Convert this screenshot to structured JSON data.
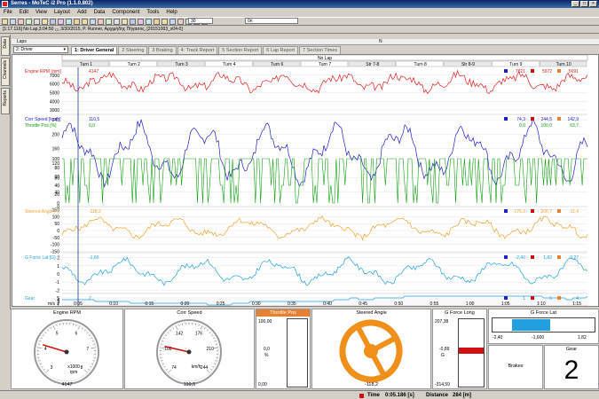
{
  "window": {
    "title": "Serres - MoTeC i2 Pro (1.1.0.802)"
  },
  "menu": [
    "File",
    "Edit",
    "View",
    "Layout",
    "Add",
    "Data",
    "Component",
    "Tools",
    "Help"
  ],
  "toolbar": {
    "combo_value": "30",
    "nav_combo_value": "0n"
  },
  "file_info": "[1:17.116] No Lap,3:04:50 ₁₂, 3/30/2015, P. Runner, Αρχιμήδης Πήγασος, [20151003_s04-0]",
  "side_tabs": [
    "Data",
    "Channels",
    "Reports"
  ],
  "laps_row": {
    "label": "Laps",
    "marker": "N"
  },
  "driver_select": "2: Driver",
  "tabs": [
    "1: Driver General",
    "2 Steering",
    "3 Braking",
    "4: Track Report",
    "5 Section Report",
    "6 Lap Report",
    "7 Section Times"
  ],
  "active_tab": 0,
  "chart": {
    "no_lap_label": "No Lap",
    "turns": [
      "Turn 1",
      "Turn 2",
      "Turn 3",
      "Turn 4",
      "Turn 6",
      "Turn 7",
      "Str 7-8",
      "Turn 8",
      "Str 8-9",
      "Turn 9",
      "Turn 10"
    ],
    "time_ticks": [
      "0:05",
      "0:10",
      "0:15",
      "0:20",
      "0:25",
      "0:30",
      "0:35",
      "0:40",
      "0:45",
      "0:50",
      "0:55",
      "1:00",
      "1:05",
      "1:10",
      "1:15"
    ],
    "x_unit": "m/s",
    "panels": [
      {
        "name": "Engine RPM [rpm]",
        "value": "4147",
        "ticks": [
          "7000",
          "6000",
          "5000",
          "4000",
          "3000"
        ],
        "stats": [
          "7821",
          "5972",
          "5691"
        ],
        "color": "#e02020"
      },
      {
        "name": "Corr Speed [km/h]",
        "value": "110,5",
        "ticks": [
          "240",
          "200",
          "160",
          "120",
          "80",
          "40",
          "0"
        ],
        "stats": [
          "74,3",
          "244,5",
          "142,9"
        ],
        "color": "#2020c8"
      },
      {
        "name": "Throttle Pos [%]",
        "value": "0,0",
        "ticks": [
          "100",
          "80",
          "60",
          "40",
          "20",
          "0"
        ],
        "stats": [
          "0,0",
          "100,0",
          "63,7"
        ],
        "color": "#10a010"
      },
      {
        "name": "Steered Angle [°]",
        "value": "-118,2",
        "ticks": [
          "150",
          "100",
          "50",
          "0",
          "-50",
          "-100",
          "-150"
        ],
        "stats": [
          "-176,3",
          "206,7",
          "11,4"
        ],
        "color": "#f0a030"
      },
      {
        "name": "G Force Lat [G]",
        "value": "-1,60",
        "ticks": [
          "2",
          "1",
          "0",
          "-1",
          "-2"
        ],
        "stats": [
          "-2,40",
          "1,82",
          "0,27"
        ],
        "color": "#20a0e0"
      },
      {
        "name": "Gear",
        "value": "2",
        "ticks": [
          "5",
          "4",
          "3",
          "2",
          "1"
        ],
        "stats": [
          "1",
          "6",
          "4"
        ],
        "color": "#20a0e0"
      }
    ]
  },
  "gauges": {
    "rpm": {
      "title": "Engine RPM",
      "value": "4147",
      "labels": [
        "3",
        "4",
        "5",
        "6",
        "7",
        "8"
      ],
      "units": [
        "x1000",
        "rpm"
      ],
      "value_num": 4147
    },
    "speed": {
      "title": "Corr Speed",
      "value": "110,5",
      "labels": [
        "74",
        "108",
        "142",
        "176",
        "210",
        "244"
      ],
      "units": [
        "km/h"
      ],
      "value_num": 110.5
    },
    "throttle": {
      "title": "Throttle Pos",
      "top": "100,00",
      "unit": "%",
      "mid": "0,0",
      "bottom": "0,00",
      "value_num": 0
    },
    "steer": {
      "title": "Steered Angle",
      "value": "-118,2",
      "value_num": -118.2
    },
    "gforce_long": {
      "title": "G Force Long",
      "top": "207,38",
      "mid": "-0,89",
      "unit": "G",
      "bottom": "-314,59"
    },
    "gforce_lat": {
      "title": "G Force Lat",
      "left": "-2,40",
      "mid": "-1,600",
      "right": "1,82",
      "value_num": -1.6
    },
    "brakes": {
      "label": "Brakes"
    },
    "gear": {
      "title": "Gear",
      "value": "2"
    }
  },
  "status": {
    "time_label": "Time",
    "time_value": "0:05.186 [s]",
    "distance_label": "Distance",
    "distance_value": "284 [m]"
  }
}
